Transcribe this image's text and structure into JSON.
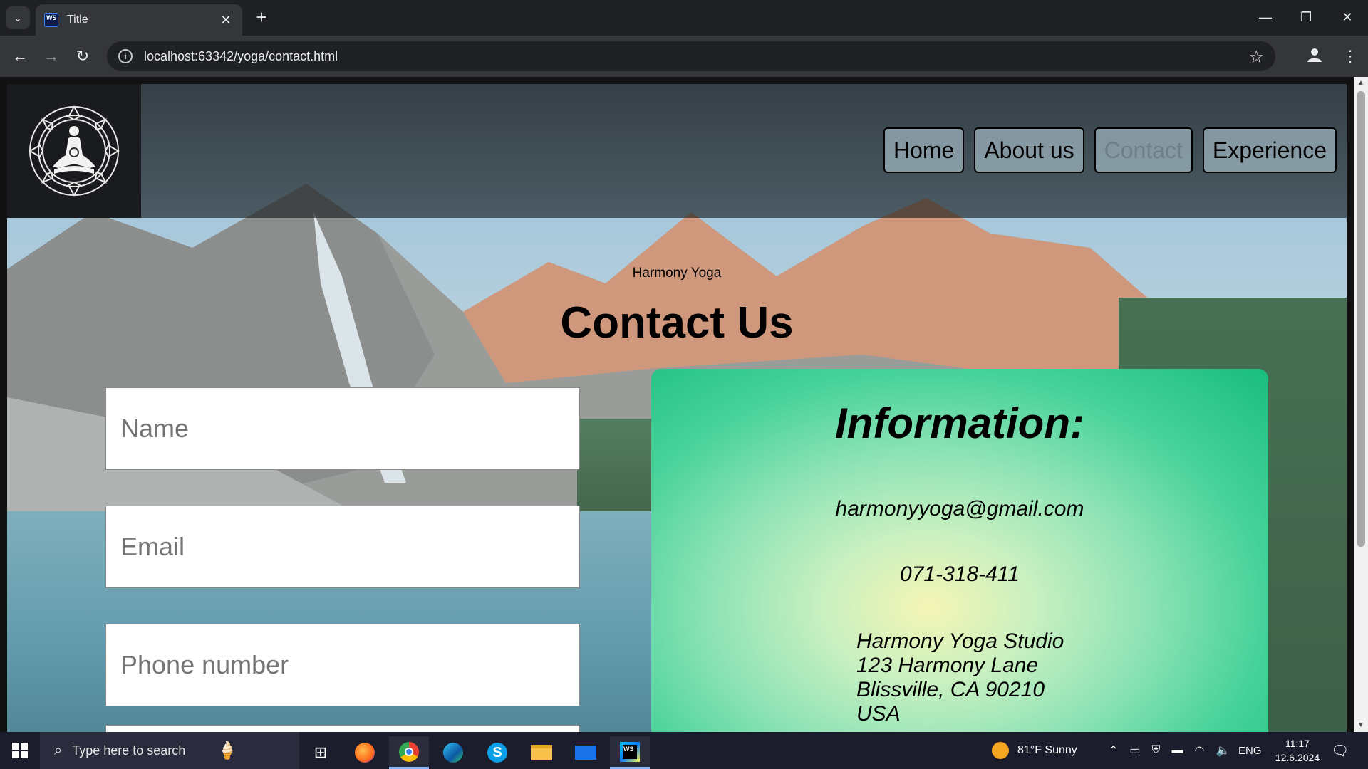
{
  "browser": {
    "tab_title": "Title",
    "favicon_text": "WS",
    "url": "localhost:63342/yoga/contact.html"
  },
  "site": {
    "nav": [
      {
        "label": "Home",
        "active": false
      },
      {
        "label": "About us",
        "active": false
      },
      {
        "label": "Contact",
        "active": true
      },
      {
        "label": "Experience",
        "active": false
      }
    ],
    "brand": "Harmony Yoga",
    "title": "Contact Us"
  },
  "form": {
    "name_placeholder": "Name",
    "email_placeholder": "Email",
    "phone_placeholder": "Phone number"
  },
  "info": {
    "heading": "Information:",
    "email": "harmonyyoga@gmail.com",
    "phone": "071-318-411",
    "address_line1": "Harmony Yoga Studio",
    "address_line2": "123 Harmony Lane",
    "address_line3": "Blissville, CA 90210",
    "address_line4": "USA"
  },
  "taskbar": {
    "search_placeholder": "Type here to search",
    "weather": "81°F  Sunny",
    "language": "ENG",
    "time": "11:17",
    "date": "12.6.2024"
  }
}
